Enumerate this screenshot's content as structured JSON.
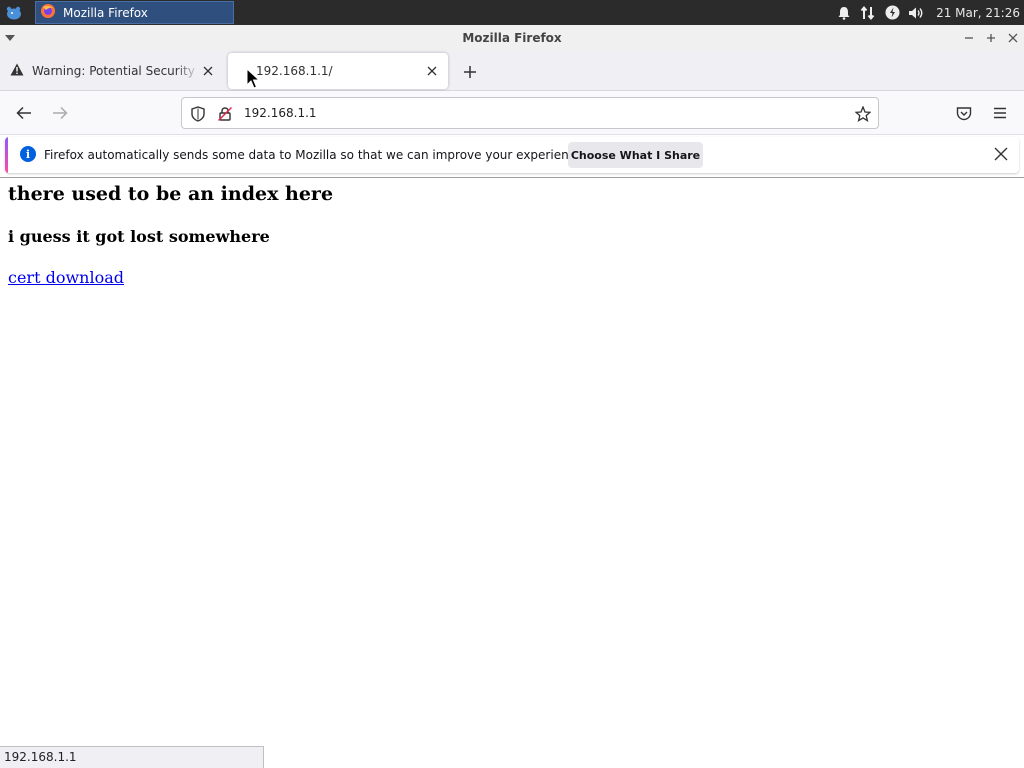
{
  "panel": {
    "task_label": "Mozilla Firefox",
    "clock": "21 Mar, 21:26"
  },
  "window": {
    "title": "Mozilla Firefox"
  },
  "tabs": [
    {
      "title": "Warning: Potential Security Risk Ahead",
      "icon": "warning-icon",
      "active": false
    },
    {
      "title": "192.168.1.1/",
      "icon": "none",
      "active": true
    }
  ],
  "navbar": {
    "url": "192.168.1.1"
  },
  "notification": {
    "message": "Firefox automatically sends some data to Mozilla so that we can improve your experience.",
    "button_label": "Choose What I Share"
  },
  "page": {
    "heading": "there used to be an index here",
    "subheading": "i guess it got lost somewhere",
    "link_text": "cert download"
  },
  "statusbar": {
    "text": "192.168.1.1"
  },
  "colors": {
    "panel_bg": "#2b2b2b",
    "task_active": "#2f4f7f",
    "link": "#0000ee",
    "info_blue": "#0060df"
  }
}
